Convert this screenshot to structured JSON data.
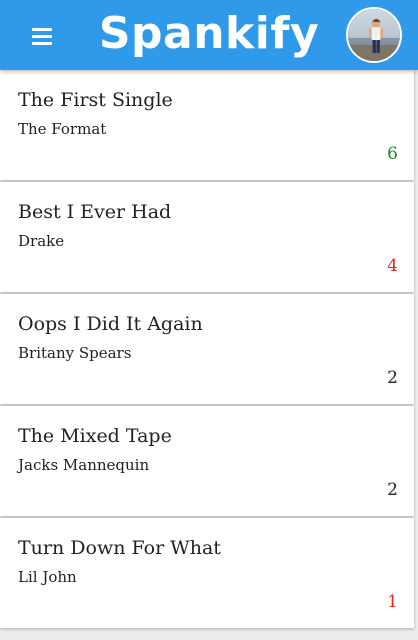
{
  "header": {
    "title": "Spankify",
    "menu_icon": "hamburger-menu-icon",
    "avatar_icon": "user-avatar",
    "background_color": "#2f9ae9"
  },
  "songs": [
    {
      "title": "The First Single",
      "artist": "The Format",
      "count": "6",
      "count_color": "#1e8a1e"
    },
    {
      "title": "Best I Ever Had",
      "artist": "Drake",
      "count": "4",
      "count_color": "#e02424"
    },
    {
      "title": "Oops I Did It Again",
      "artist": "Britany Spears",
      "count": "2",
      "count_color": "#222222"
    },
    {
      "title": "The Mixed Tape",
      "artist": "Jacks Mannequin",
      "count": "2",
      "count_color": "#222222"
    },
    {
      "title": "Turn Down For What",
      "artist": "Lil John",
      "count": "1",
      "count_color": "#e02424"
    }
  ]
}
